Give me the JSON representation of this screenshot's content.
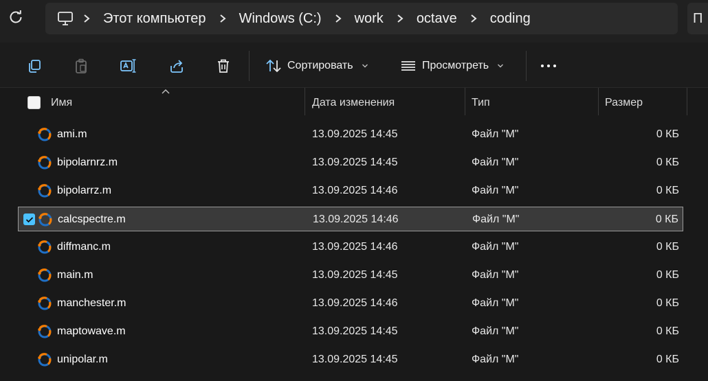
{
  "address_bar": {
    "refresh_icon": "refresh-icon",
    "pc_icon": "monitor-icon",
    "breadcrumbs": [
      "Этот компьютер",
      "Windows (C:)",
      "work",
      "octave",
      "coding"
    ],
    "search_stub": "П"
  },
  "command_bar": {
    "icons": [
      "copy-icon",
      "paste-icon",
      "rename-icon",
      "share-icon",
      "delete-icon"
    ],
    "sort_label": "Сортировать",
    "view_label": "Просмотреть",
    "more_icon": "more-icon"
  },
  "columns": {
    "name": "Имя",
    "date": "Дата изменения",
    "type": "Тип",
    "size": "Размер"
  },
  "files": [
    {
      "name": "ami.m",
      "date": "13.09.2025 14:45",
      "type": "Файл \"M\"",
      "size": "0 КБ",
      "selected": false
    },
    {
      "name": "bipolarnrz.m",
      "date": "13.09.2025 14:45",
      "type": "Файл \"M\"",
      "size": "0 КБ",
      "selected": false
    },
    {
      "name": "bipolarrz.m",
      "date": "13.09.2025 14:46",
      "type": "Файл \"M\"",
      "size": "0 КБ",
      "selected": false
    },
    {
      "name": "calcspectre.m",
      "date": "13.09.2025 14:46",
      "type": "Файл \"M\"",
      "size": "0 КБ",
      "selected": true
    },
    {
      "name": "diffmanc.m",
      "date": "13.09.2025 14:46",
      "type": "Файл \"M\"",
      "size": "0 КБ",
      "selected": false
    },
    {
      "name": "main.m",
      "date": "13.09.2025 14:45",
      "type": "Файл \"M\"",
      "size": "0 КБ",
      "selected": false
    },
    {
      "name": "manchester.m",
      "date": "13.09.2025 14:46",
      "type": "Файл \"M\"",
      "size": "0 КБ",
      "selected": false
    },
    {
      "name": "maptowave.m",
      "date": "13.09.2025 14:45",
      "type": "Файл \"M\"",
      "size": "0 КБ",
      "selected": false
    },
    {
      "name": "unipolar.m",
      "date": "13.09.2025 14:45",
      "type": "Файл \"M\"",
      "size": "0 КБ",
      "selected": false
    }
  ],
  "colors": {
    "background": "#191919",
    "accent": "#4cc2ff",
    "selected_row": "#3a3a3a",
    "file_icon_orange": "#f57c00",
    "file_icon_blue": "#1f6fc5"
  }
}
